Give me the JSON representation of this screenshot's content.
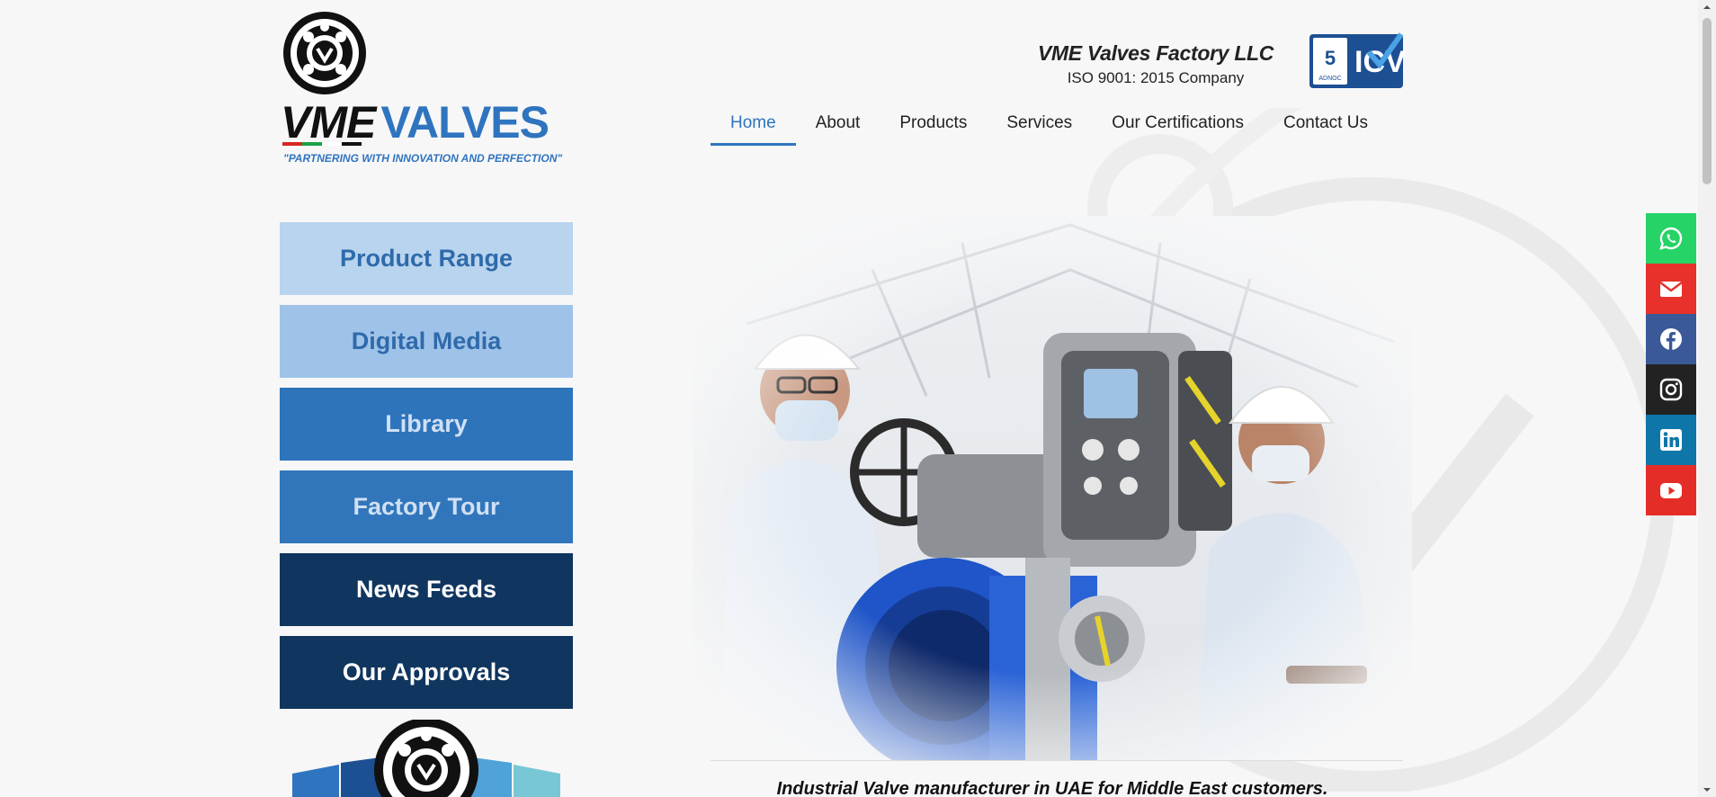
{
  "brand": {
    "logo_word_dark": "VME",
    "logo_word_blue": "VALVES",
    "tagline": "\"PARTNERING WITH INNOVATION AND PERFECTION\"",
    "company_name": "VME Valves Factory LLC",
    "iso_line": "ISO 9001: 2015 Company",
    "badge_mark": "ICV",
    "badge_sub": "ADNOC",
    "colors": {
      "blue": "#2f74bf",
      "navy": "#10365f",
      "light_blue": "#b8d4ee"
    }
  },
  "nav": {
    "items": [
      {
        "label": "Home",
        "active": true
      },
      {
        "label": "About",
        "active": false
      },
      {
        "label": "Products",
        "active": false
      },
      {
        "label": "Services",
        "active": false
      },
      {
        "label": "Our Certifications",
        "active": false
      },
      {
        "label": "Contact Us",
        "active": false
      }
    ]
  },
  "sidebar": {
    "buttons": [
      {
        "label": "Product Range"
      },
      {
        "label": "Digital Media"
      },
      {
        "label": "Library"
      },
      {
        "label": "Factory Tour"
      },
      {
        "label": "News Feeds"
      },
      {
        "label": "Our Approvals"
      }
    ]
  },
  "hero": {
    "image": "engineers-inspecting-actuated-butterfly-valve",
    "caption": "Industrial Valve manufacturer in UAE for Middle East customers."
  },
  "social": [
    {
      "icon": "whatsapp-icon",
      "color": "#25d366"
    },
    {
      "icon": "email-icon",
      "color": "#e8312a"
    },
    {
      "icon": "facebook-icon",
      "color": "#3b5998"
    },
    {
      "icon": "instagram-icon",
      "color": "#222222"
    },
    {
      "icon": "linkedin-icon",
      "color": "#0e76a8"
    },
    {
      "icon": "youtube-icon",
      "color": "#e52d27"
    }
  ]
}
